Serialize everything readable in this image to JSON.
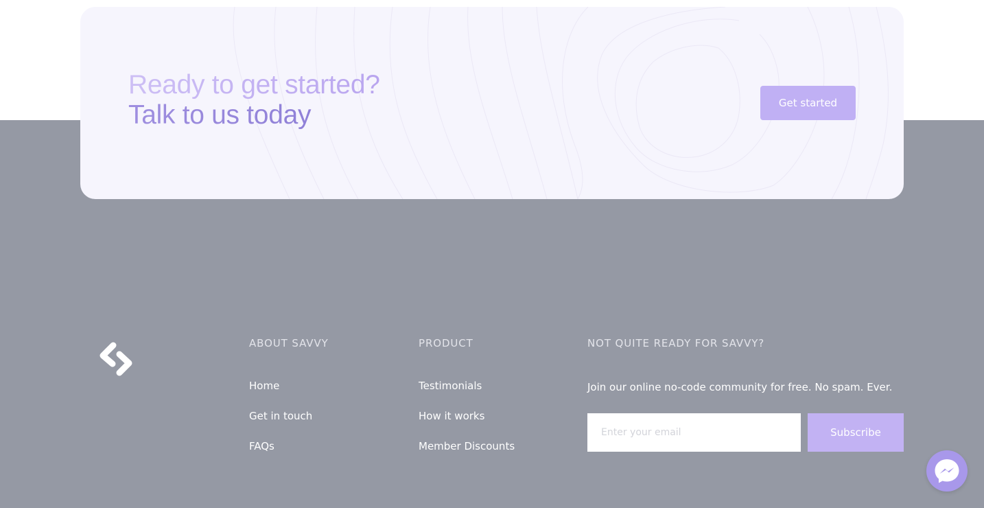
{
  "cta": {
    "line1": "Ready to get started?",
    "line2": "Talk to us today",
    "button_label": "Get started"
  },
  "logo": {
    "icon": "chevron-brand-logo"
  },
  "footer": {
    "about": {
      "heading": "ABOUT SAVVY",
      "links": [
        "Home",
        "Get in touch",
        "FAQs"
      ]
    },
    "product": {
      "heading": "PRODUCT",
      "links": [
        "Testimonials",
        "How it works",
        "Member Discounts"
      ]
    },
    "newsletter": {
      "heading": "NOT QUITE READY FOR SAVVY?",
      "text": "Join our online no-code community for free. No spam. Ever.",
      "email_placeholder": "Enter your email",
      "email_value": "",
      "subscribe_label": "Subscribe"
    }
  },
  "chat_widget": {
    "icon": "messenger-icon"
  },
  "colors": {
    "footer_background": "#9599a4",
    "card_background": "#f6f5fd",
    "accent": "#c0b0f4",
    "heading_light": "#cdbff5",
    "heading_dark": "#8a7bd4",
    "messenger": "#a898ea"
  }
}
